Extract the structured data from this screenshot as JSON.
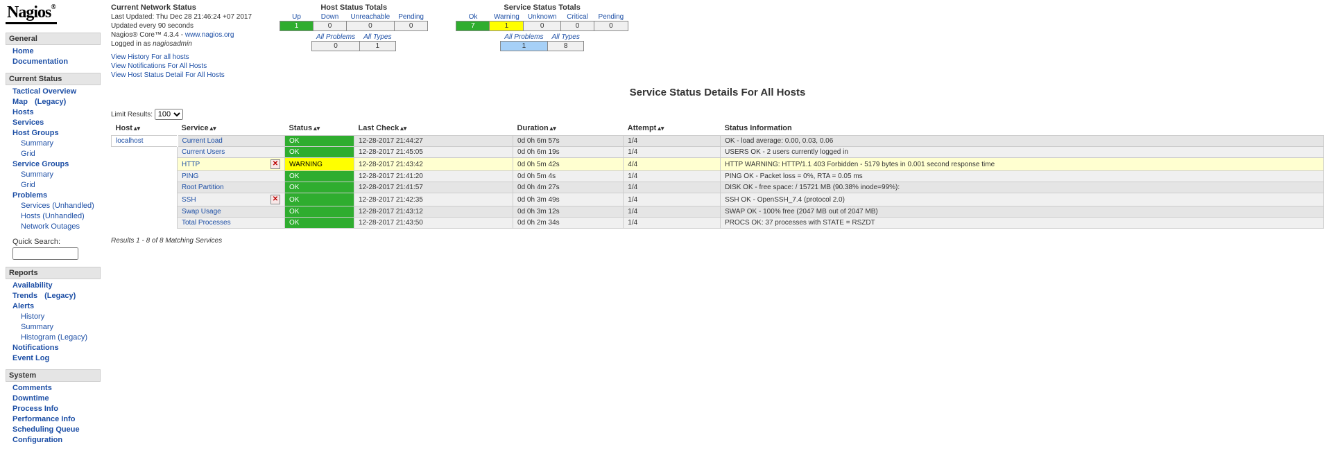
{
  "logo": {
    "text": "Nagios",
    "reg": "®"
  },
  "nav": {
    "general": {
      "title": "General",
      "items": [
        "Home",
        "Documentation"
      ]
    },
    "current_status": {
      "title": "Current Status",
      "tactical": "Tactical Overview",
      "map": "Map",
      "map_legacy": "(Legacy)",
      "hosts": "Hosts",
      "services": "Services",
      "host_groups": "Host Groups",
      "hg_summary": "Summary",
      "hg_grid": "Grid",
      "service_groups": "Service Groups",
      "sg_summary": "Summary",
      "sg_grid": "Grid",
      "problems": "Problems",
      "p_services": "Services",
      "p_unhandled_s": "(Unhandled)",
      "p_hosts": "Hosts",
      "p_unhandled_h": "(Unhandled)",
      "p_outages": "Network Outages",
      "quick_search": "Quick Search:"
    },
    "reports": {
      "title": "Reports",
      "availability": "Availability",
      "trends": "Trends",
      "trends_legacy": "(Legacy)",
      "alerts": "Alerts",
      "a_history": "History",
      "a_summary": "Summary",
      "a_histogram": "Histogram (Legacy)",
      "notifications": "Notifications",
      "event_log": "Event Log"
    },
    "system": {
      "title": "System",
      "items": [
        "Comments",
        "Downtime",
        "Process Info",
        "Performance Info",
        "Scheduling Queue",
        "Configuration"
      ]
    }
  },
  "info": {
    "title": "Current Network Status",
    "updated": "Last Updated: Thu Dec 28 21:46:24 +07 2017",
    "interval": "Updated every 90 seconds",
    "version_pre": "Nagios® Core™ 4.3.4 - ",
    "version_link": "www.nagios.org",
    "logged_pre": "Logged in as ",
    "logged_user": "nagiosadmin",
    "link1": "View History For all hosts",
    "link2": "View Notifications For All Hosts",
    "link3": "View Host Status Detail For All Hosts"
  },
  "host_totals": {
    "title": "Host Status Totals",
    "h_up": "Up",
    "h_down": "Down",
    "h_unreach": "Unreachable",
    "h_pending": "Pending",
    "v_up": "1",
    "v_down": "0",
    "v_unreach": "0",
    "v_pending": "0",
    "h_allprob": "All Problems",
    "h_alltypes": "All Types",
    "v_allprob": "0",
    "v_alltypes": "1"
  },
  "svc_totals": {
    "title": "Service Status Totals",
    "h_ok": "Ok",
    "h_warn": "Warning",
    "h_unk": "Unknown",
    "h_crit": "Critical",
    "h_pend": "Pending",
    "v_ok": "7",
    "v_warn": "1",
    "v_unk": "0",
    "v_crit": "0",
    "v_pend": "0",
    "h_allprob": "All Problems",
    "h_alltypes": "All Types",
    "v_allprob": "1",
    "v_alltypes": "8"
  },
  "page_title": "Service Status Details For All Hosts",
  "limit_label": "Limit Results:",
  "limit_value": "100",
  "table": {
    "h_host": "Host",
    "h_service": "Service",
    "h_status": "Status",
    "h_last": "Last Check",
    "h_dur": "Duration",
    "h_att": "Attempt",
    "h_info": "Status Information",
    "rows": [
      {
        "host": "localhost",
        "svc": "Current Load",
        "icon": "",
        "status": "OK",
        "status_cls": "status-ok",
        "row_cls": "even",
        "last": "12-28-2017 21:44:27",
        "dur": "0d 0h 6m 57s",
        "att": "1/4",
        "info": "OK - load average: 0.00, 0.03, 0.06"
      },
      {
        "host": "",
        "svc": "Current Users",
        "icon": "",
        "status": "OK",
        "status_cls": "status-ok",
        "row_cls": "odd",
        "last": "12-28-2017 21:45:05",
        "dur": "0d 0h 6m 19s",
        "att": "1/4",
        "info": "USERS OK - 2 users currently logged in"
      },
      {
        "host": "",
        "svc": "HTTP",
        "icon": "X",
        "status": "WARNING",
        "status_cls": "status-warning",
        "row_cls": "warning-row",
        "last": "12-28-2017 21:43:42",
        "dur": "0d 0h 5m 42s",
        "att": "4/4",
        "info": "HTTP WARNING: HTTP/1.1 403 Forbidden - 5179 bytes in 0.001 second response time"
      },
      {
        "host": "",
        "svc": "PING",
        "icon": "",
        "status": "OK",
        "status_cls": "status-ok",
        "row_cls": "odd",
        "last": "12-28-2017 21:41:20",
        "dur": "0d 0h 5m 4s",
        "att": "1/4",
        "info": "PING OK - Packet loss = 0%, RTA = 0.05 ms"
      },
      {
        "host": "",
        "svc": "Root Partition",
        "icon": "",
        "status": "OK",
        "status_cls": "status-ok",
        "row_cls": "even",
        "last": "12-28-2017 21:41:57",
        "dur": "0d 0h 4m 27s",
        "att": "1/4",
        "info": "DISK OK - free space: / 15721 MB (90.38% inode=99%):"
      },
      {
        "host": "",
        "svc": "SSH",
        "icon": "X",
        "status": "OK",
        "status_cls": "status-ok",
        "row_cls": "odd",
        "last": "12-28-2017 21:42:35",
        "dur": "0d 0h 3m 49s",
        "att": "1/4",
        "info": "SSH OK - OpenSSH_7.4 (protocol 2.0)"
      },
      {
        "host": "",
        "svc": "Swap Usage",
        "icon": "",
        "status": "OK",
        "status_cls": "status-ok",
        "row_cls": "even",
        "last": "12-28-2017 21:43:12",
        "dur": "0d 0h 3m 12s",
        "att": "1/4",
        "info": "SWAP OK - 100% free (2047 MB out of 2047 MB)"
      },
      {
        "host": "",
        "svc": "Total Processes",
        "icon": "",
        "status": "OK",
        "status_cls": "status-ok",
        "row_cls": "odd",
        "last": "12-28-2017 21:43:50",
        "dur": "0d 0h 2m 34s",
        "att": "1/4",
        "info": "PROCS OK: 37 processes with STATE = RSZDT"
      }
    ]
  },
  "results_line": "Results 1 - 8 of 8 Matching Services"
}
